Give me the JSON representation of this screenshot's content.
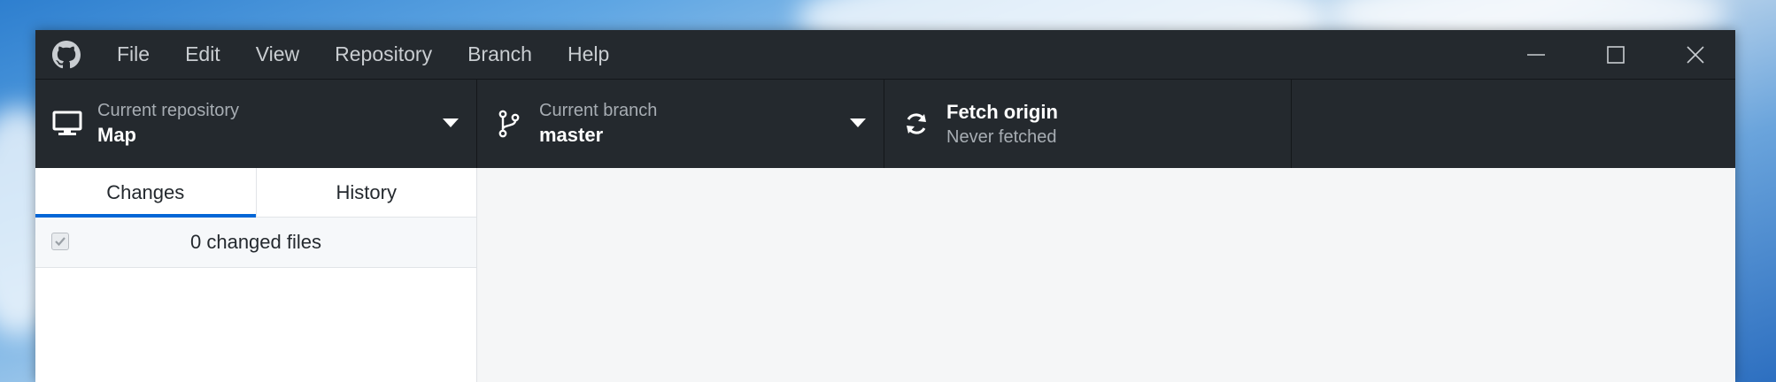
{
  "menu": {
    "items": [
      "File",
      "Edit",
      "View",
      "Repository",
      "Branch",
      "Help"
    ]
  },
  "toolbar": {
    "repository": {
      "label": "Current repository",
      "value": "Map"
    },
    "branch": {
      "label": "Current branch",
      "value": "master"
    },
    "fetch": {
      "label": "Fetch origin",
      "status": "Never fetched"
    }
  },
  "sidebar": {
    "tabs": [
      "Changes",
      "History"
    ],
    "active_tab": "Changes",
    "changes_count": "0 changed files"
  },
  "icons": {
    "app": "github-icon",
    "repository": "desktop-icon",
    "branch": "git-branch-icon",
    "fetch": "sync-icon"
  },
  "colors": {
    "titlebar": "#24292e",
    "accent": "#0366d6"
  }
}
